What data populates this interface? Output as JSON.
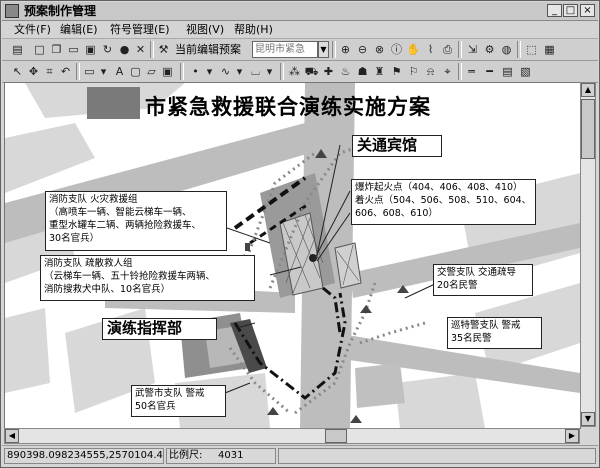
{
  "window": {
    "title": "预案制作管理",
    "minimize": "_",
    "maximize": "□",
    "close": "×"
  },
  "menu": [
    {
      "label": "文件(F)"
    },
    {
      "label": "编辑(E)"
    },
    {
      "label": "符号管理(E)"
    },
    {
      "label": "视图(V)"
    },
    {
      "label": "帮助(H)"
    }
  ],
  "toolbar": {
    "current_plan_label": "当前编辑预案",
    "current_plan_value": "昆明市紧急"
  },
  "map": {
    "title": "市紧急救援联合演练实施方案",
    "hotel_label": "关通宾馆",
    "command_label": "演练指挥部",
    "ignition_lines": [
      "爆炸起火点（404、406、408、410）",
      "着火点（504、506、508、510、604、",
      "606、608、610）"
    ],
    "fire_team_lines": [
      "消防支队  火灾救援组",
      "（高喷车一辆、智能云梯车一辆、",
      "重型水罐车二辆、两辆抢险救援车、",
      "30名官兵）"
    ],
    "rescue_team_lines": [
      "消防支队  疏散救人组",
      "（云梯车一辆、五十铃抢险救援车两辆、",
      "消防搜救犬中队、10名官兵）"
    ],
    "traffic_lines": [
      "交警支队  交通疏导",
      "20名民警"
    ],
    "special_police_lines": [
      "巡特警支队  警戒",
      "35名民警"
    ],
    "armed_police_lines": [
      "武警市支队  警戒",
      "50名官兵"
    ]
  },
  "status": {
    "coordinates": "890398.098234555,2570104.44673",
    "scale_label": "比例尺:",
    "scale_value": "4031"
  }
}
